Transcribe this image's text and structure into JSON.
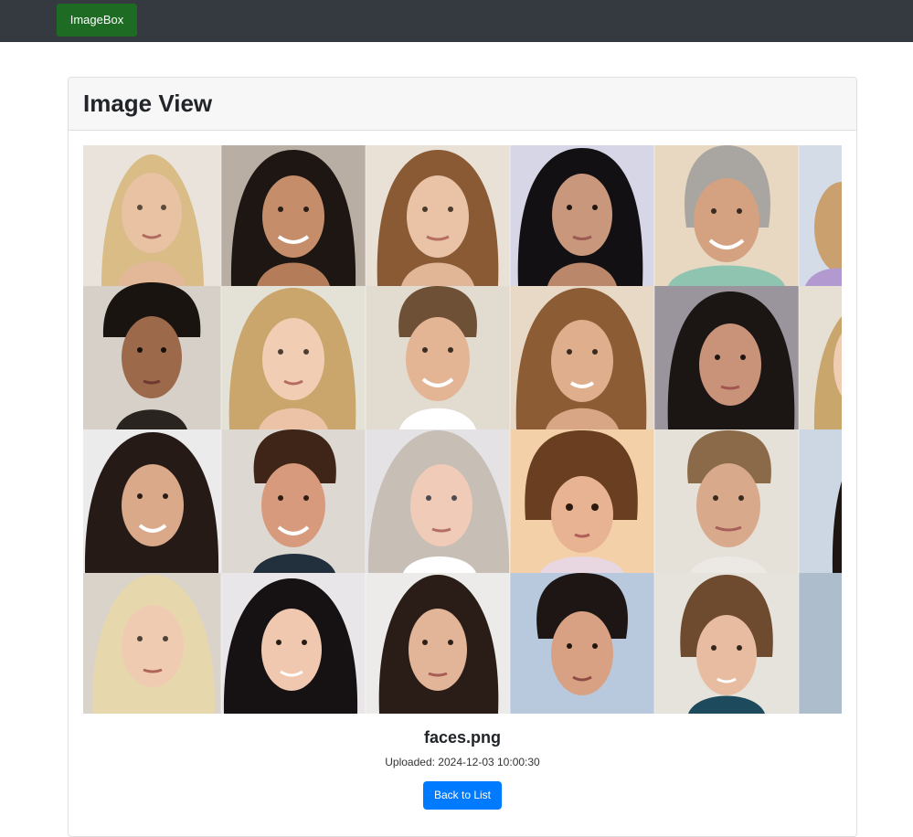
{
  "navbar": {
    "brand": "ImageBox",
    "brand_color": "#1e6b24",
    "background": "#343a40"
  },
  "card": {
    "title": "Image View"
  },
  "image": {
    "description_icon": "face-portrait-grid",
    "filename": "faces.png",
    "uploaded": "Uploaded: 2024-12-03 10:00:30"
  },
  "actions": {
    "back_label": "Back to List",
    "back_color": "#007bff"
  }
}
